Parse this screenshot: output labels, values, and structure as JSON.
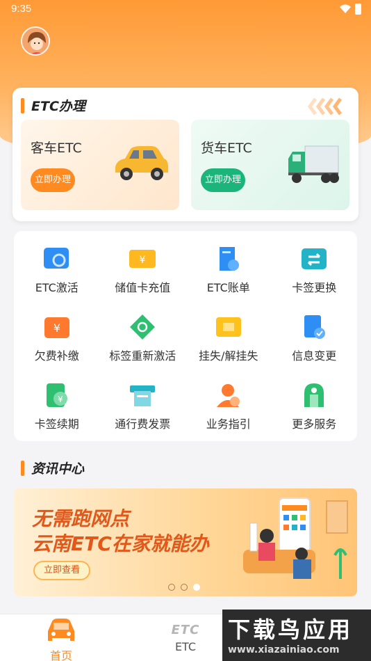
{
  "status_bar": {
    "time": "9:35"
  },
  "etc_section": {
    "title": "ETC办理",
    "car": {
      "label": "客车ETC",
      "button": "立即办理"
    },
    "truck": {
      "label": "货车ETC",
      "button": "立即办理"
    }
  },
  "services": [
    {
      "label": "ETC激活",
      "icon": "card-refresh-icon"
    },
    {
      "label": "储值卡充值",
      "icon": "yen-card-icon"
    },
    {
      "label": "ETC账单",
      "icon": "bill-icon"
    },
    {
      "label": "卡签更换",
      "icon": "swap-card-icon"
    },
    {
      "label": "欠费补缴",
      "icon": "yen-wallet-icon"
    },
    {
      "label": "标签重新激活",
      "icon": "tag-refresh-icon"
    },
    {
      "label": "挂失/解挂失",
      "icon": "lock-card-icon"
    },
    {
      "label": "信息变更",
      "icon": "document-check-icon"
    },
    {
      "label": "卡签续期",
      "icon": "yen-renew-icon"
    },
    {
      "label": "通行费发票",
      "icon": "invoice-printer-icon"
    },
    {
      "label": "业务指引",
      "icon": "guide-person-icon"
    },
    {
      "label": "更多服务",
      "icon": "more-services-icon"
    }
  ],
  "news_section": {
    "title": "资讯中心",
    "banner": {
      "line1": "无需跑网点",
      "line2": "云南ETC在家就能办",
      "button": "立即查看"
    }
  },
  "bottom_nav": [
    {
      "label": "首页",
      "active": true
    },
    {
      "label": "ETC",
      "logo": "ETC",
      "active": false
    }
  ],
  "watermark": {
    "big": "下载鸟应用",
    "small": "www.xiazainiao.com"
  },
  "colors": {
    "accent": "#ff8a1f",
    "green": "#1bb57b"
  }
}
